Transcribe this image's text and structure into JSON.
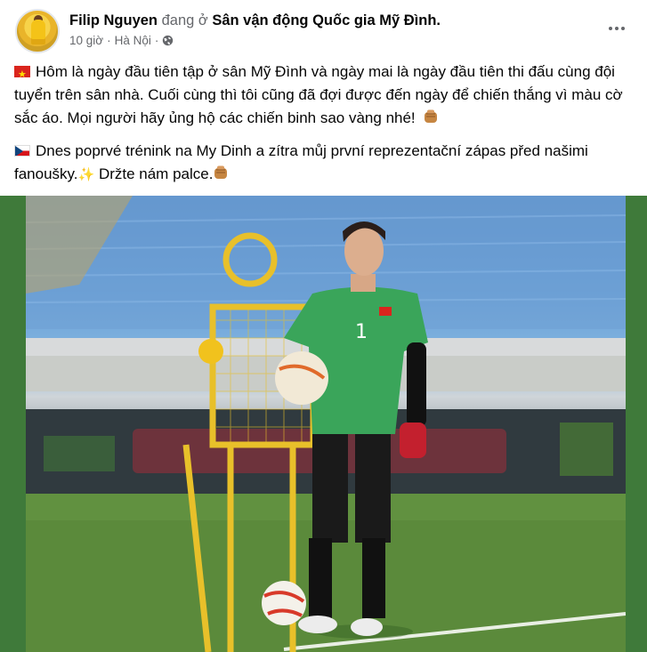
{
  "post": {
    "author": "Filip Nguyen",
    "verb": "đang ở",
    "location": "Sân vận động Quốc gia Mỹ Đình.",
    "time": "10 giờ",
    "separator": "·",
    "city": "Hà Nội",
    "city_separator": "·",
    "paragraph_vi": "Hôm là ngày đầu tiên tập ở sân Mỹ Đình và ngày mai là ngày đầu tiên thi đấu cùng đội tuyển trên sân nhà. Cuối cùng thì tôi cũng đã đợi được đến ngày để chiến thắng vì màu cờ sắc áo. Mọi người hãy ủng hộ các chiến binh sao vàng nhé!",
    "paragraph_cz": "Dnes poprvé trénink na My Dinh a zítra můj první reprezentační zápas před našimi fanoušky.",
    "paragraph_cz_end": "Držte nám palce.",
    "photo_jersey_number": "1"
  },
  "icons": {
    "more": "more-horizontal-icon",
    "privacy": "globe-icon",
    "flag_vn": "vietnam-flag-icon",
    "flag_cz": "czech-flag-icon",
    "fist": "fist-emoji-icon",
    "sparkles": "sparkles-emoji-icon"
  },
  "colors": {
    "secondary_text": "#65676b",
    "vn_red": "#da251d",
    "vn_yellow": "#ffdd00",
    "jersey_green": "#3aa55a",
    "pitch_green": "#5f8c3c"
  }
}
